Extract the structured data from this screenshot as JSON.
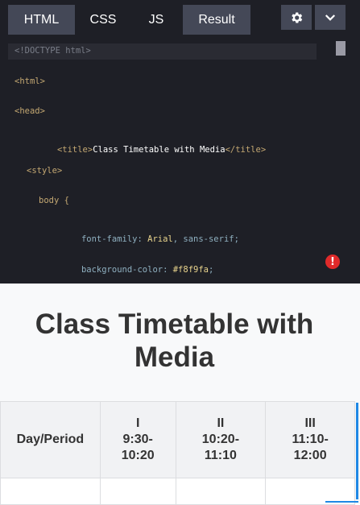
{
  "tabs": [
    {
      "label": "HTML"
    },
    {
      "label": "CSS"
    },
    {
      "label": "JS"
    },
    {
      "label": "Result"
    }
  ],
  "toolbar": {
    "settings_icon": "gear-icon",
    "menu_icon": "chevron-down-icon"
  },
  "code": {
    "lines": [
      {
        "text": "<!DOCTYPE html>"
      },
      {
        "text": "<html>"
      },
      {
        "text": "<head>"
      },
      {
        "open": "<title>",
        "content": "Class Timetable with Media",
        "close": "</title>"
      },
      {
        "text": "<style>"
      },
      {
        "text": "body {"
      },
      {
        "prop": "font-family:",
        "value": "Arial",
        "rest": ", sans-serif;"
      },
      {
        "prop": "background-color:",
        "value": "#f8f9fa",
        "rest": ";"
      }
    ],
    "error_icon": "!"
  },
  "result": {
    "title": "Class Timetable with Media",
    "headers": [
      {
        "l1": "Day/Period"
      },
      {
        "l1": "I",
        "l2": "9:30-",
        "l3": "10:20"
      },
      {
        "l1": "II",
        "l2": "10:20-",
        "l3": "11:10"
      },
      {
        "l1": "III",
        "l2": "11:10-",
        "l3": "12:00"
      }
    ]
  },
  "colors": {
    "editor_bg": "#1e1f26",
    "tab_active": "#444857",
    "error": "#e02a2a",
    "result_bg": "#f8f9fa",
    "accent_blue": "#1e88e5"
  }
}
